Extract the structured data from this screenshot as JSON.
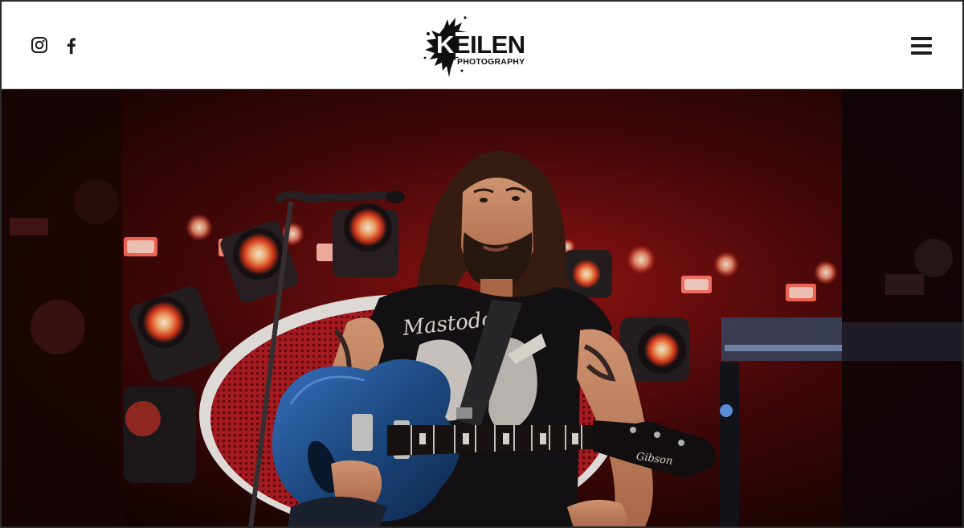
{
  "header": {
    "social": [
      {
        "name": "instagram",
        "icon": "instagram-icon"
      },
      {
        "name": "facebook",
        "icon": "facebook-icon"
      }
    ],
    "logo": {
      "word_first": "K",
      "word_rest": "EILEN",
      "sub": "PHOTOGRAPHY"
    },
    "menu_icon": "hamburger-menu-icon"
  },
  "hero": {
    "guitar_brand": "Gibson",
    "shirt_text": "Mastodon"
  },
  "colors": {
    "header_bg": "#ffffff",
    "icon": "#1c1c1c",
    "stage_red": "#c81e1e",
    "guitar_blue": "#1f4f8a"
  }
}
